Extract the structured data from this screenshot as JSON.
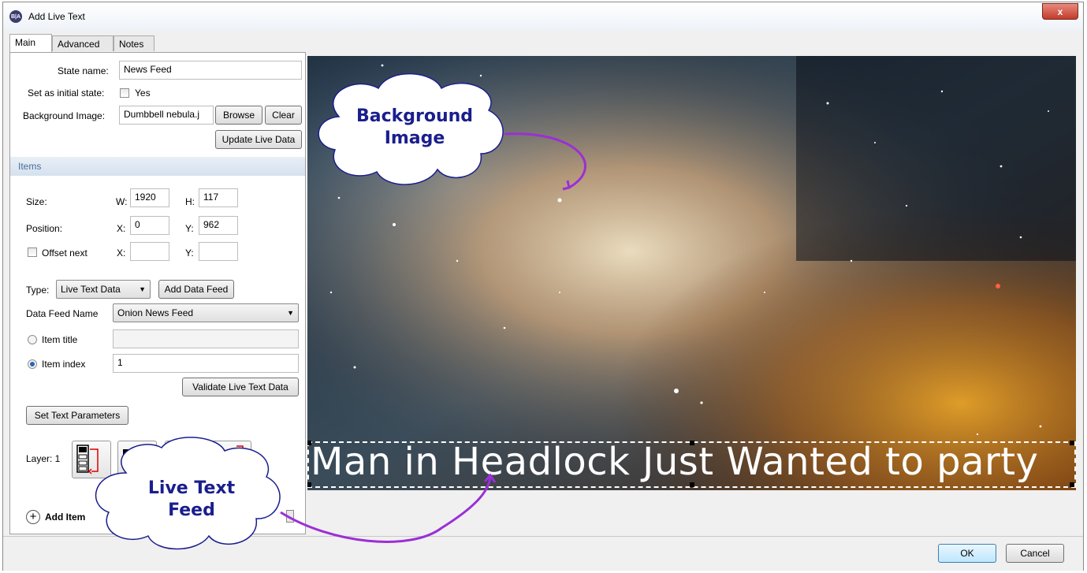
{
  "window": {
    "title": "Add Live Text",
    "app_icon": "B|A",
    "close_label": "x"
  },
  "tabs": [
    {
      "label": "Main",
      "active": true
    },
    {
      "label": "Advanced",
      "active": false
    },
    {
      "label": "Notes",
      "active": false
    }
  ],
  "main": {
    "state_name_label": "State name:",
    "state_name_value": "News Feed",
    "initial_state_label": "Set as initial state:",
    "initial_state_option": "Yes",
    "initial_state_checked": false,
    "background_image_label": "Background Image:",
    "background_image_value": "Dumbbell nebula.j",
    "browse_label": "Browse",
    "clear_label": "Clear",
    "update_live_data_label": "Update Live Data"
  },
  "items": {
    "header": "Items",
    "size_label": "Size:",
    "w_label": "W:",
    "w_value": "1920",
    "h_label": "H:",
    "h_value": "117",
    "position_label": "Position:",
    "x_label": "X:",
    "x_value": "0",
    "y_label": "Y:",
    "y_value": "962",
    "offset_label": "Offset next",
    "offset_x_label": "X:",
    "offset_x_value": "",
    "offset_y_label": "Y:",
    "offset_y_value": "",
    "type_label": "Type:",
    "type_value": "Live Text Data",
    "add_data_feed_label": "Add Data Feed",
    "data_feed_name_label": "Data Feed Name",
    "data_feed_name_value": "Onion News Feed",
    "item_title_label": "Item title",
    "item_title_value": "",
    "item_index_label": "Item index",
    "item_index_value": "1",
    "selected_radio": "item_index",
    "validate_label": "Validate Live Text Data",
    "set_text_params_label": "Set Text Parameters",
    "layer_label": "Layer: 1",
    "layer_icons": [
      "bring-to-front-icon",
      "bring-forward-icon",
      "send-backward-icon",
      "send-to-back-icon"
    ],
    "add_item_label": "Add Item"
  },
  "preview": {
    "ticker_text": "Man in Headlock Just Wanted to party"
  },
  "annotations": {
    "background_image_callout": [
      "Background",
      "Image"
    ],
    "live_text_callout": [
      "Live Text",
      "Feed"
    ],
    "arrow_color": "#9b2fd6",
    "callout_text_color": "#1a1e8c"
  },
  "footer": {
    "ok_label": "OK",
    "cancel_label": "Cancel"
  }
}
